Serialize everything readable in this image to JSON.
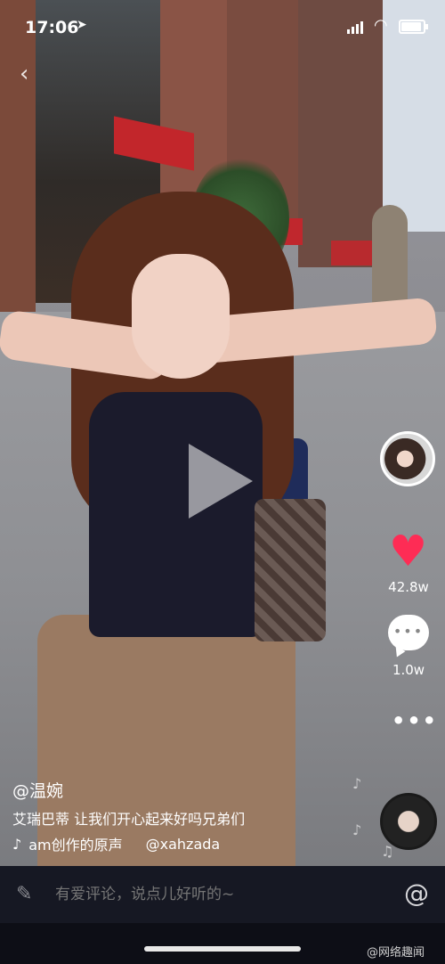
{
  "status_bar": {
    "time": "17:06",
    "location_icon": "location-arrow-icon",
    "signal_icon": "cellular-signal-icon",
    "wifi_icon": "wifi-icon",
    "battery_icon": "battery-icon",
    "battery_level": 0.85
  },
  "video": {
    "play_icon": "play-icon"
  },
  "right_rail": {
    "likes": "42.8w",
    "comments": "1.0w",
    "like_color": "#fe2c55"
  },
  "caption": {
    "username": "@温婉",
    "description": "艾瑞巴蒂 让我们开心起来好吗兄弟们",
    "music_title": "am创作的原声",
    "music_author": "@xahzada"
  },
  "comment_bar": {
    "placeholder": "有爱评论，说点儿好听的~",
    "at_symbol": "@"
  },
  "watermark": "@网络趣闻"
}
